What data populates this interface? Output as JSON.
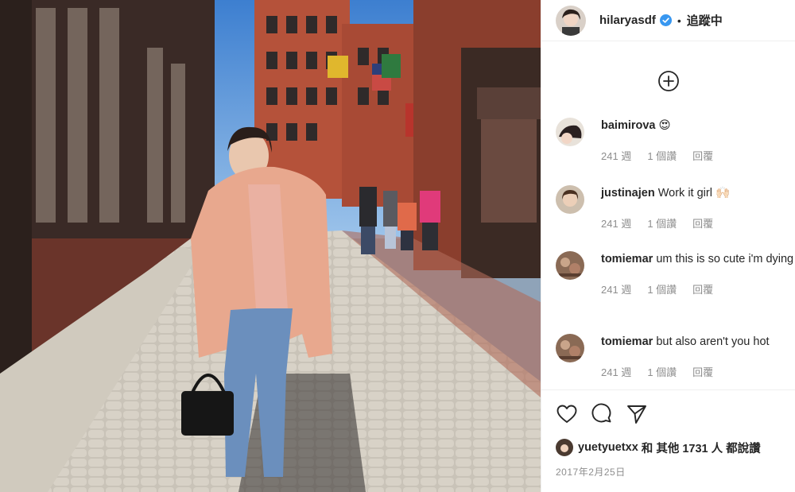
{
  "post": {
    "username": "hilaryasdf",
    "verified": true,
    "separator": "•",
    "follow_label": "追蹤中"
  },
  "comments": [
    {
      "username": "baimirova",
      "text": "",
      "emoji": "😍",
      "age": "241 週",
      "likes": "1 個讚",
      "reply": "回覆"
    },
    {
      "username": "justinajen",
      "text": "Work it girl",
      "emoji": "🙌🏻",
      "age": "241 週",
      "likes": "1 個讚",
      "reply": "回覆"
    },
    {
      "username": "tomiemar",
      "text": "um this is so cute i'm dying",
      "emoji": "",
      "age": "241 週",
      "likes": "1 個讚",
      "reply": "回覆"
    },
    {
      "username": "tomiemar",
      "text": "but also aren't you hot",
      "emoji": "",
      "age": "241 週",
      "likes": "1 個讚",
      "reply": "回覆"
    }
  ],
  "likes_summary": {
    "liker": "yuetyuetxx",
    "rest": "和 其他 1731 人 都說讚"
  },
  "date": "2017年2月25日",
  "icons": [
    "add-comment-icon",
    "heart-icon",
    "comment-icon",
    "share-icon",
    "verified-icon"
  ],
  "colors": {
    "verified": "#3897f0",
    "meta_text": "#8e8e8e",
    "divider": "#efefef"
  }
}
